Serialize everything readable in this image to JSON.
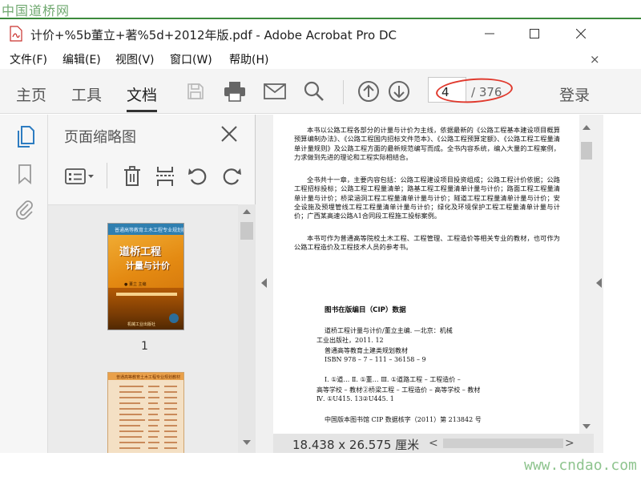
{
  "watermark_top": "中国道桥网",
  "watermark_bottom": "www.cndao.com",
  "window": {
    "title": "计价+%5b董立+著%5d+2012年版.pdf - Adobe Acrobat Pro DC"
  },
  "menu": {
    "items": [
      "文件(F)",
      "编辑(E)",
      "视图(V)",
      "窗口(W)",
      "帮助(H)"
    ],
    "close_glyph": "×"
  },
  "toolbar": {
    "tabs": [
      "主页",
      "工具",
      "文档"
    ],
    "active_tab": "文档",
    "page_current": "4",
    "page_total": "/ 376",
    "login": "登录",
    "highlight_color": "#e03a2e"
  },
  "thumbnails": {
    "panel_title": "页面缩略图",
    "pages": [
      {
        "number": "1",
        "cover_header": "普通高等教育土木工程专业规划教材",
        "cover_title_1": "道桥工程",
        "cover_title_2": "计量与计价",
        "cover_author": "● 董立 主编",
        "cover_publisher": "机械工业出版社"
      },
      {
        "number": "",
        "header": "普通高等教育土木工程专业规划教材"
      }
    ]
  },
  "document": {
    "paragraphs": [
      "本书以公路工程各部分的计量与计价为主线，依据最新的《公路工程基本建设项目概算预算编制办法》、《公路工程国内招标文件范本》、《公路工程预算定额》、《公路工程工程量清单计量规则》及公路工程方面的最新规范编写而成。全书内容系统，编入大量的工程案例，力求做到先进的理论和工程实际相结合。",
      "全书共十一章，主要内容包括：公路工程建设项目投资组成；公路工程计价依据；公路工程招标投标；公路工程工程量清单；路基工程工程量清单计量与计价；路面工程工程量清单计量与计价；桥梁涵洞工程工程量清单计量与计价；隧道工程工程量清单计量与计价；安全设施及预埋管线工程工程量清单计量与计价；绿化及环境保护工程工程量清单计量与计价；广西某高速公路A1合同段工程施工投标案例。",
      "本书可作为普通高等院校土木工程、工程管理、工程造价等相关专业的教材，也可作为公路工程造价及工程技术人员的参考书。"
    ],
    "cip_title": "图书在版编目（CIP）数据",
    "cip_lines": [
      "道桥工程计量与计价/董立主编. —北京：机械",
      "工业出版社，2011. 12",
      "普通高等教育土建类规划教材",
      "ISBN 978 – 7 – 111 – 36158 – 9",
      "Ⅰ. ①道…   Ⅱ. ①董…   Ⅲ. ①道路工程 – 工程造价 –",
      "高等学校 – 教材②桥梁工程 – 工程造价 – 高等学校 – 教材",
      "Ⅳ. ①U415. 13②U445. 1",
      "中国版本图书馆 CIP 数据核字（2011）第 213842 号"
    ]
  },
  "status": {
    "dimensions": "18.438 x 26.575 厘米",
    "scroll_left": "<",
    "scroll_right": ">"
  }
}
